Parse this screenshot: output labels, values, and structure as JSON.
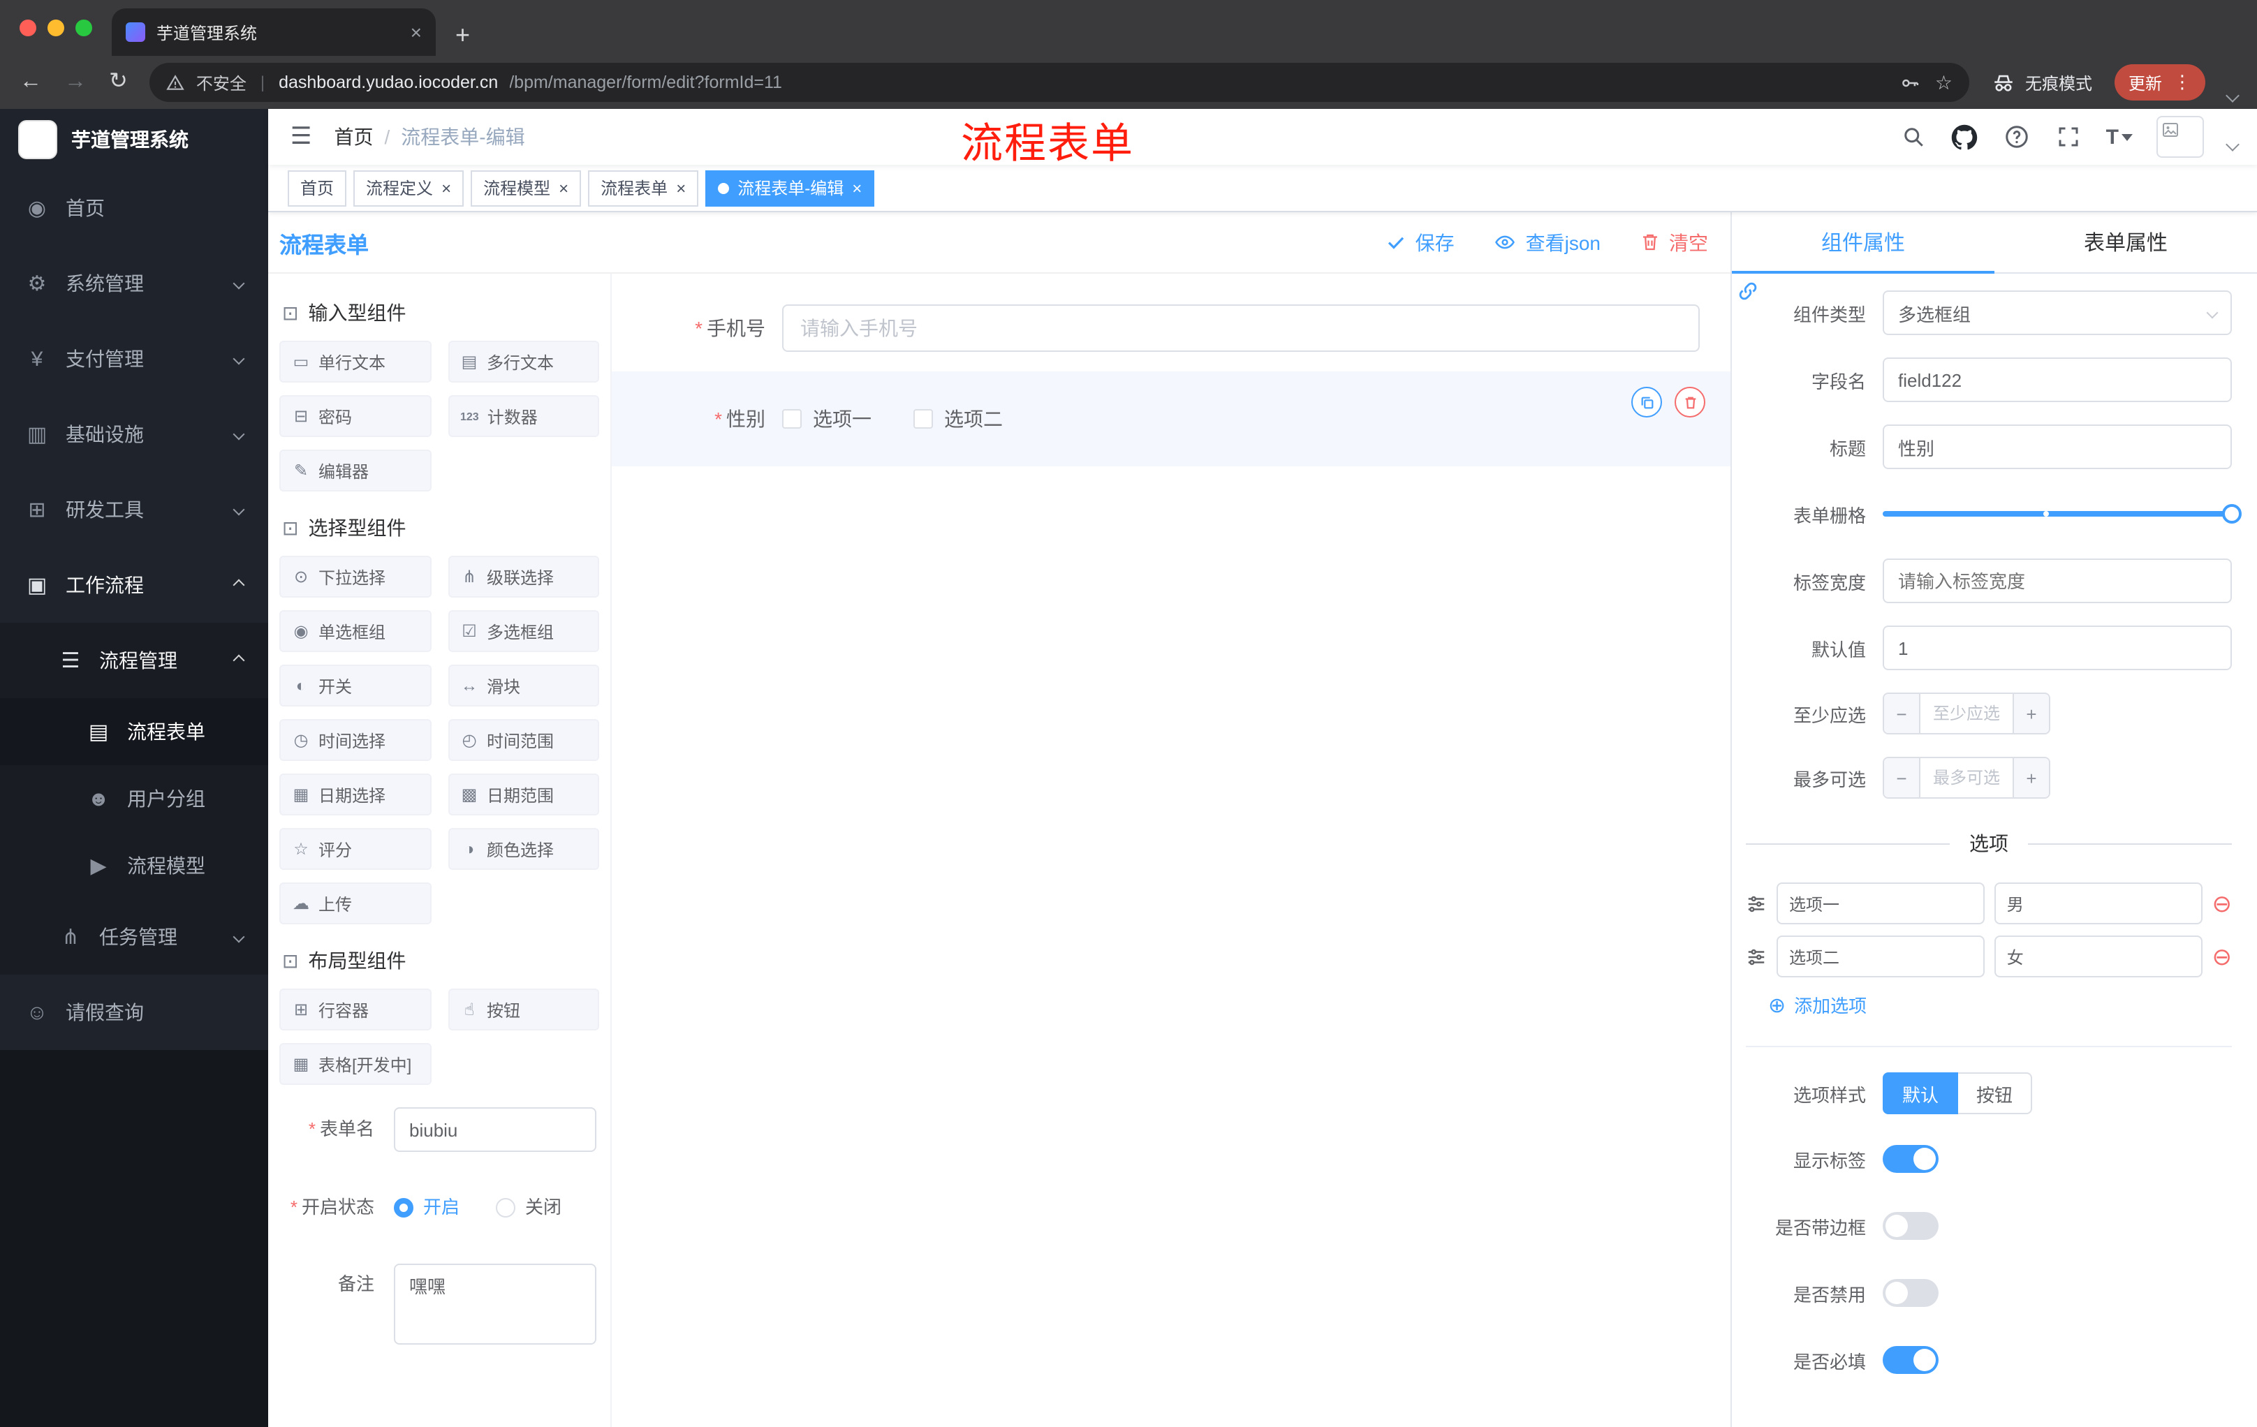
{
  "ui": {
    "required_mark": "*"
  },
  "browser": {
    "tab_title": "芋道管理系统",
    "security_label": "不安全",
    "url_host": "dashboard.yudao.iocoder.cn",
    "url_path": "/bpm/manager/form/edit?formId=11",
    "incognito_label": "无痕模式",
    "update_label": "更新"
  },
  "sidebar": {
    "app_title": "芋道管理系统",
    "items": [
      {
        "label": "首页",
        "icon": "◉"
      },
      {
        "label": "系统管理",
        "icon": "⚙"
      },
      {
        "label": "支付管理",
        "icon": "¥"
      },
      {
        "label": "基础设施",
        "icon": "▥"
      },
      {
        "label": "研发工具",
        "icon": "⊞"
      },
      {
        "label": "工作流程",
        "icon": "▣"
      },
      {
        "label": "流程管理",
        "icon": "☰"
      },
      {
        "label": "流程表单",
        "icon": "▤"
      },
      {
        "label": "用户分组",
        "icon": "☻"
      },
      {
        "label": "流程模型",
        "icon": "▶"
      },
      {
        "label": "任务管理",
        "icon": "⋔"
      },
      {
        "label": "请假查询",
        "icon": "☺"
      }
    ]
  },
  "header": {
    "breadcrumb_home": "首页",
    "breadcrumb_sep": "/",
    "breadcrumb_current": "流程表单-编辑",
    "overlay_title": "流程表单"
  },
  "tagsbar": {
    "tabs": [
      {
        "label": "首页"
      },
      {
        "label": "流程定义"
      },
      {
        "label": "流程模型"
      },
      {
        "label": "流程表单"
      },
      {
        "label": "流程表单-编辑"
      }
    ]
  },
  "designer": {
    "panel_title": "流程表单",
    "actions": {
      "save": "保存",
      "view_json": "查看json",
      "clear": "清空"
    },
    "palette": {
      "group1_title": "输入型组件",
      "group1": [
        {
          "label": "单行文本",
          "icon": "▭"
        },
        {
          "label": "多行文本",
          "icon": "▤"
        },
        {
          "label": "密码",
          "icon": "⊟"
        },
        {
          "label": "计数器",
          "icon": "123"
        },
        {
          "label": "编辑器",
          "icon": "✎"
        }
      ],
      "group2_title": "选择型组件",
      "group2": [
        {
          "label": "下拉选择",
          "icon": "⊙"
        },
        {
          "label": "级联选择",
          "icon": "⋔"
        },
        {
          "label": "单选框组",
          "icon": "◉"
        },
        {
          "label": "多选框组",
          "icon": "☑"
        },
        {
          "label": "开关",
          "icon": "◐"
        },
        {
          "label": "滑块",
          "icon": "↔"
        },
        {
          "label": "时间选择",
          "icon": "◷"
        },
        {
          "label": "时间范围",
          "icon": "◴"
        },
        {
          "label": "日期选择",
          "icon": "▦"
        },
        {
          "label": "日期范围",
          "icon": "▩"
        },
        {
          "label": "评分",
          "icon": "☆"
        },
        {
          "label": "颜色选择",
          "icon": "◑"
        },
        {
          "label": "上传",
          "icon": "☁"
        }
      ],
      "group3_title": "布局型组件",
      "group3": [
        {
          "label": "行容器",
          "icon": "⊞"
        },
        {
          "label": "按钮",
          "icon": "☝"
        },
        {
          "label": "表格[开发中]",
          "icon": "▦"
        }
      ]
    },
    "meta": {
      "name_label": "表单名",
      "name_value": "biubiu",
      "status_label": "开启状态",
      "status_on": "开启",
      "status_off": "关闭",
      "remark_label": "备注",
      "remark_value": "嘿嘿"
    },
    "canvas": {
      "phone_label": "手机号",
      "phone_placeholder": "请输入手机号",
      "gender_label": "性别",
      "gender_option1": "选项一",
      "gender_option2": "选项二"
    }
  },
  "props": {
    "tab_component": "组件属性",
    "tab_form": "表单属性",
    "type_label": "组件类型",
    "type_value": "多选框组",
    "field_label": "字段名",
    "field_value": "field122",
    "title_label": "标题",
    "title_value": "性别",
    "grid_label": "表单栅格",
    "label_width_label": "标签宽度",
    "label_width_placeholder": "请输入标签宽度",
    "default_label": "默认值",
    "default_value": "1",
    "min_label": "至少应选",
    "min_placeholder": "至少应选",
    "max_label": "最多可选",
    "max_placeholder": "最多可选",
    "options_title": "选项",
    "options": [
      {
        "label": "选项一",
        "value": "男"
      },
      {
        "label": "选项二",
        "value": "女"
      }
    ],
    "add_option": "添加选项",
    "style_label": "选项样式",
    "style_default": "默认",
    "style_button": "按钮",
    "show_label": "显示标签",
    "border_label": "是否带边框",
    "disabled_label": "是否禁用",
    "required_label": "是否必填"
  }
}
